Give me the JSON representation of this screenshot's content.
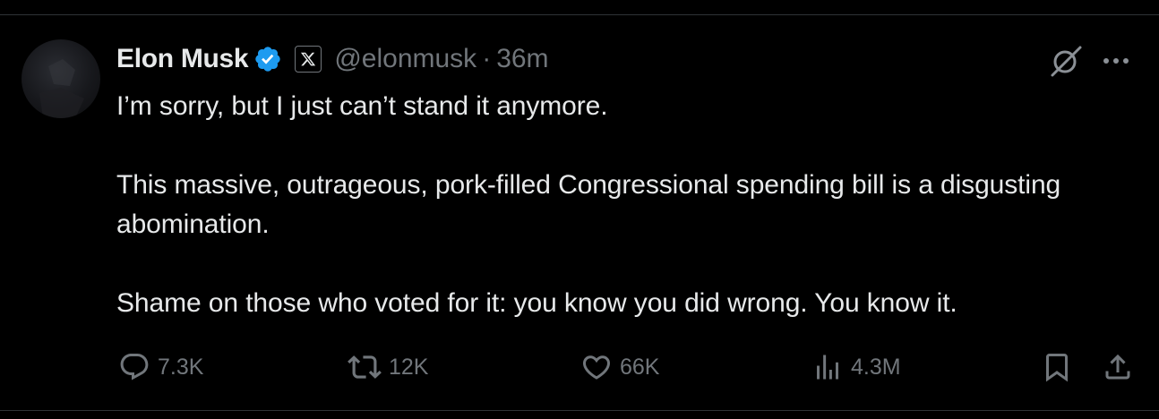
{
  "tweet": {
    "author": {
      "display_name": "Elon Musk",
      "handle": "@elonmusk",
      "verified_icon": "verified-badge-icon",
      "affiliation_icon": "x-logo-icon"
    },
    "separator": "·",
    "time": "36m",
    "paragraphs": [
      "I’m sorry, but I just can’t stand it anymore.",
      "This massive, outrageous, pork-filled Congressional spending bill is a disgusting abomination.",
      "Shame on those who voted for it: you know you did wrong. You know it."
    ],
    "header_icons": {
      "grok": "grok-icon",
      "more": "more-icon"
    },
    "actions": {
      "replies": "7.3K",
      "reposts": "12K",
      "likes": "66K",
      "views": "4.3M"
    },
    "colors": {
      "background": "#000000",
      "text": "#e7e9ea",
      "secondary_text": "#71767b",
      "verified": "#1d9bf0",
      "divider": "#2f3336"
    }
  }
}
